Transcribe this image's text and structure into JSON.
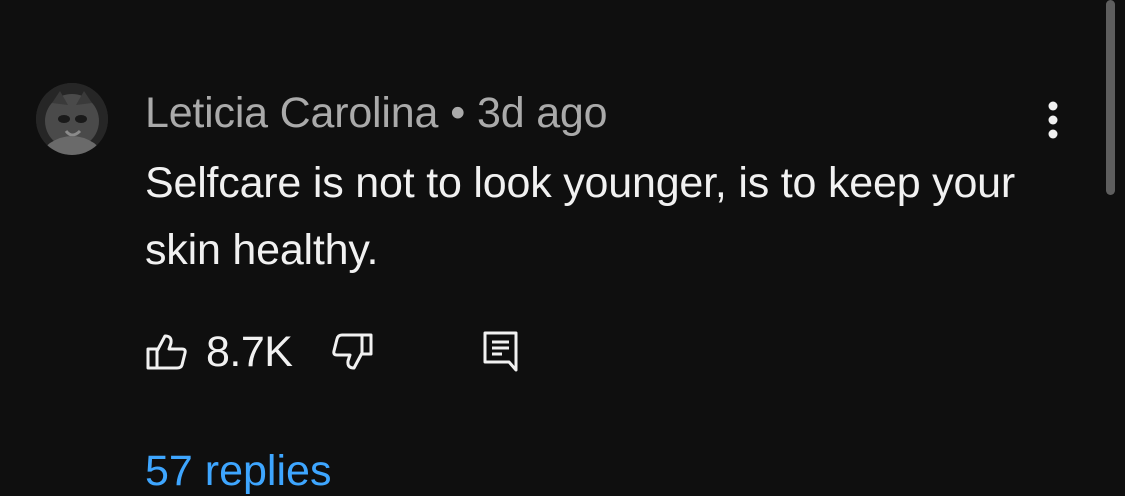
{
  "comment": {
    "author": "Leticia Carolina",
    "separator": "•",
    "time": "3d ago",
    "text": "Selfcare is not to look younger, is to keep your skin healthy.",
    "likes": "8.7K",
    "replies_link": "57 replies"
  },
  "icons": {
    "avatar": "avatar-cat-photo",
    "more": "more-vertical-icon",
    "like": "thumbs-up-icon",
    "dislike": "thumbs-down-icon",
    "reply": "reply-comment-icon"
  },
  "colors": {
    "background": "#0f0f0f",
    "primary_text": "#f1f1f1",
    "secondary_text": "#aaaaaa",
    "link": "#3ea6ff"
  }
}
